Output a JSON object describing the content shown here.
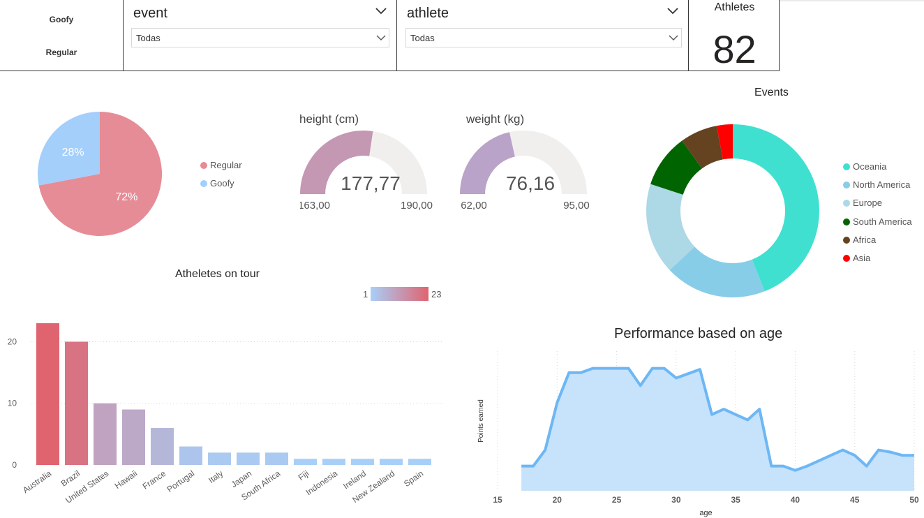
{
  "stance_slicer": {
    "items": [
      "Goofy",
      "Regular"
    ]
  },
  "event_slicer": {
    "title": "event",
    "value": "Todas"
  },
  "athlete_slicer": {
    "title": "athlete",
    "value": "Todas"
  },
  "athletes_card": {
    "label": "Athletes",
    "value": "82"
  },
  "gauges": [
    {
      "title": "height (cm)",
      "value": 177.77,
      "min": 163,
      "max": 190,
      "value_label": "177,77",
      "min_label": "163,00",
      "max_label": "190,00",
      "color": "#c497b2"
    },
    {
      "title": "weight (kg)",
      "value": 76.16,
      "min": 62,
      "max": 95,
      "value_label": "76,16",
      "min_label": "62,00",
      "max_label": "95,00",
      "color": "#b9a3c8"
    }
  ],
  "gradient_legend": {
    "min_label": "1",
    "max_label": "23",
    "color_low": "#a8cff8",
    "color_high": "#e06470"
  },
  "chart_data": [
    {
      "type": "pie",
      "labels": [
        "Regular",
        "Goofy"
      ],
      "values": [
        72,
        28
      ],
      "value_labels": [
        "72%",
        "28%"
      ],
      "colors": [
        "#e68c96",
        "#a4cffb"
      ],
      "legend_placement": "right"
    },
    {
      "type": "pie",
      "title": "Events",
      "donut": true,
      "labels": [
        "Oceania",
        "North America",
        "Europe",
        "South America",
        "Africa",
        "Asia"
      ],
      "values": [
        44,
        19,
        17,
        10,
        7,
        3
      ],
      "colors": [
        "#40e0d0",
        "#87cde8",
        "#add8e6",
        "#006400",
        "#654321",
        "#ff0000"
      ],
      "legend_placement": "right"
    },
    {
      "type": "bar",
      "title": "Atheletes on tour",
      "categories": [
        "Australia",
        "Brazil",
        "United States",
        "Hawaii",
        "France",
        "Portugal",
        "Italy",
        "Japan",
        "South Africa",
        "Fiji",
        "Indonesia",
        "Ireland",
        "New Zealand",
        "Spain"
      ],
      "values": [
        23,
        20,
        10,
        9,
        6,
        3,
        2,
        2,
        2,
        1,
        1,
        1,
        1,
        1
      ],
      "ylim": [
        0,
        23
      ],
      "yticks": [
        0,
        10,
        20
      ],
      "grid": true
    },
    {
      "type": "area",
      "title": "Performance based on age",
      "xlabel": "age",
      "ylabel": "Points earned",
      "x": [
        17,
        18,
        19,
        20,
        21,
        22,
        23,
        24,
        25,
        26,
        27,
        28,
        29,
        30,
        31,
        32,
        33,
        34,
        35,
        36,
        37,
        38,
        39,
        40,
        41,
        42,
        43,
        44,
        45,
        46,
        47,
        48,
        49,
        50
      ],
      "y": [
        2.3,
        2.3,
        3.8,
        8.2,
        11.0,
        11.0,
        11.4,
        11.4,
        11.4,
        11.4,
        9.8,
        11.4,
        11.4,
        10.5,
        10.9,
        11.3,
        7.1,
        7.6,
        7.1,
        6.6,
        7.6,
        2.3,
        2.3,
        1.9,
        2.3,
        2.8,
        3.3,
        3.8,
        3.3,
        2.3,
        3.8,
        3.6,
        3.3,
        3.3
      ],
      "xlim": [
        15,
        50
      ],
      "xticks": [
        15,
        20,
        25,
        30,
        35,
        40,
        45,
        50
      ],
      "ylim": [
        0,
        13
      ],
      "color": "#6db7f5",
      "fill": "#c7e2fb"
    }
  ]
}
